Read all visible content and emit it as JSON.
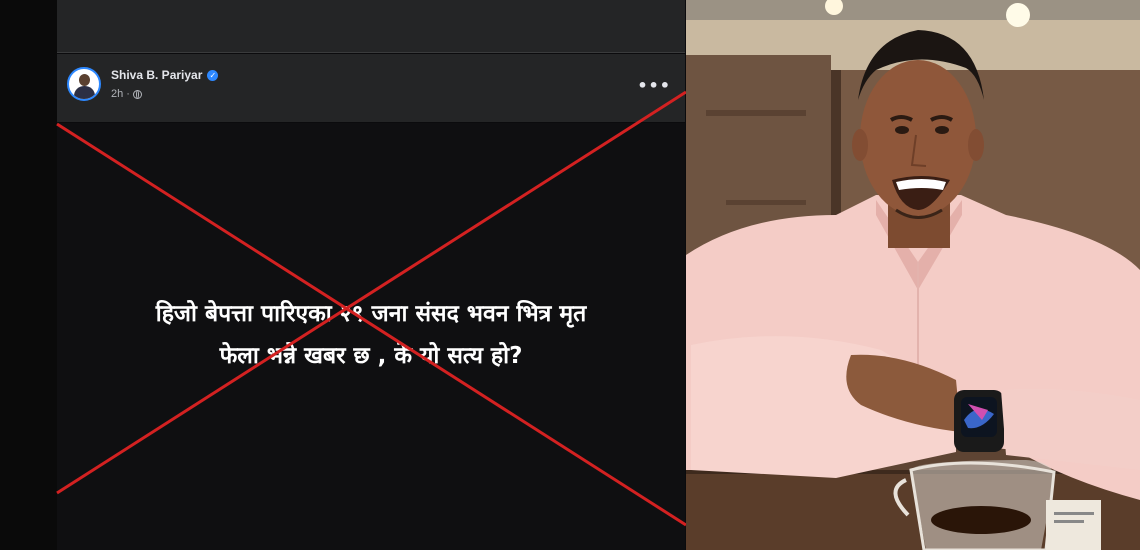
{
  "post": {
    "author": "Shiva B. Pariyar",
    "time": "2h",
    "menu": "•••",
    "text_line1": "हिजो बेपत्ता पारिएका २९ जना संसद भवन भित्र मृत",
    "text_line2": "फेला भन्ने खबर छ , के यो सत्य हो?"
  },
  "colors": {
    "cross": "#d32121",
    "card": "#242526",
    "verified": "#2d88ff"
  },
  "icons": [
    "verified-icon",
    "globe-icon",
    "more-icon"
  ]
}
